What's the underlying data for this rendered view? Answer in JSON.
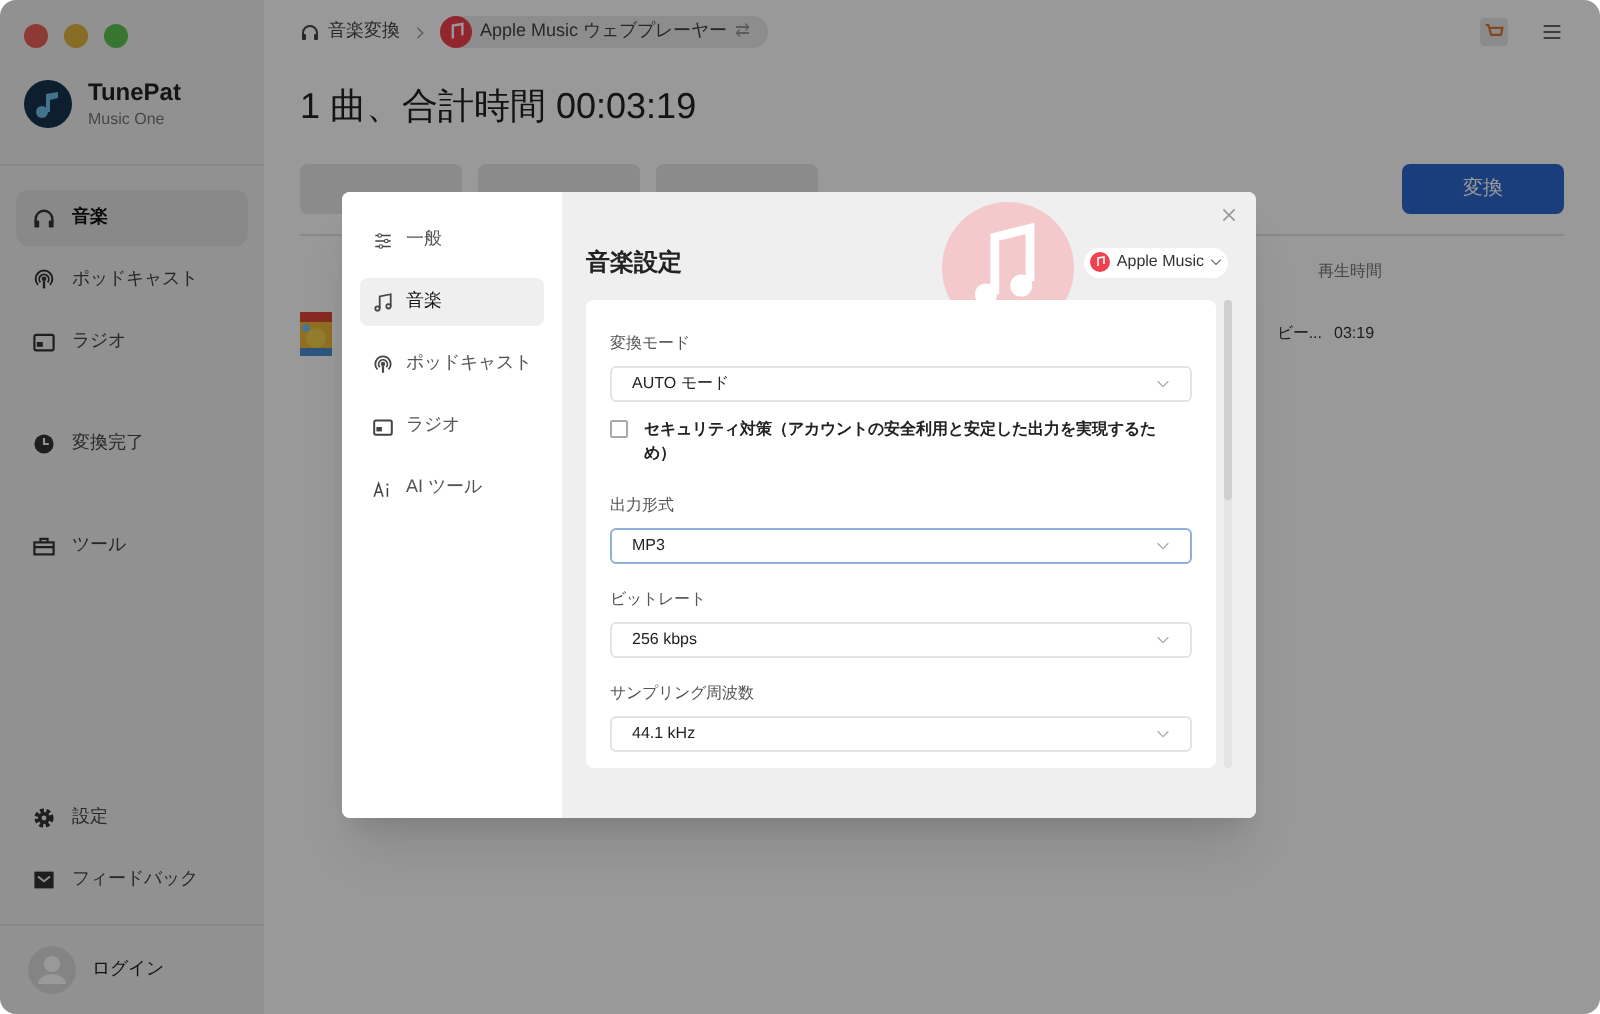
{
  "app": {
    "name": "TunePat",
    "subtitle": "Music One"
  },
  "sidebar": {
    "items": [
      {
        "label": "音楽",
        "kind": "headphones",
        "selected": true
      },
      {
        "label": "ポッドキャスト",
        "kind": "podcast",
        "selected": false
      },
      {
        "label": "ラジオ",
        "kind": "radio",
        "selected": false
      },
      {
        "label": "変換完了",
        "kind": "clock",
        "selected": false
      },
      {
        "label": "ツール",
        "kind": "toolbox",
        "selected": false
      }
    ],
    "bottom_items": [
      {
        "label": "設定",
        "kind": "gear"
      },
      {
        "label": "フィードバック",
        "kind": "mail"
      }
    ],
    "login": "ログイン"
  },
  "breadcrumb": {
    "section": "音楽変換",
    "source": "Apple Music ウェブプレーヤー",
    "swap": "⇄"
  },
  "title": "1 曲、合計時間 00:03:19",
  "convert_button": "変換",
  "table": {
    "columns": [
      {
        "label": "再生時間"
      }
    ],
    "rows": [
      {
        "title": "ビー...",
        "duration": "03:19"
      }
    ]
  },
  "dialog": {
    "nav": [
      {
        "label": "一般",
        "kind": "sliders",
        "selected": false
      },
      {
        "label": "音楽",
        "kind": "note",
        "selected": true
      },
      {
        "label": "ポッドキャスト",
        "kind": "podcast",
        "selected": false
      },
      {
        "label": "ラジオ",
        "kind": "radio",
        "selected": false
      },
      {
        "label": "AI ツール",
        "kind": "ai",
        "selected": false
      }
    ],
    "title": "音楽設定",
    "source": "Apple Music",
    "settings": [
      {
        "kind": "select",
        "label": "変換モード",
        "value": "AUTO モード",
        "focused": false
      },
      {
        "kind": "checkbox",
        "label": "セキュリティ対策（アカウントの安全利用と安定した出力を実現するため）",
        "checked": false
      },
      {
        "kind": "select",
        "label": "出力形式",
        "value": "MP3",
        "focused": true
      },
      {
        "kind": "select",
        "label": "ビットレート",
        "value": "256 kbps",
        "focused": false
      },
      {
        "kind": "select",
        "label": "サンプリング周波数",
        "value": "44.1 kHz",
        "focused": false
      }
    ]
  }
}
